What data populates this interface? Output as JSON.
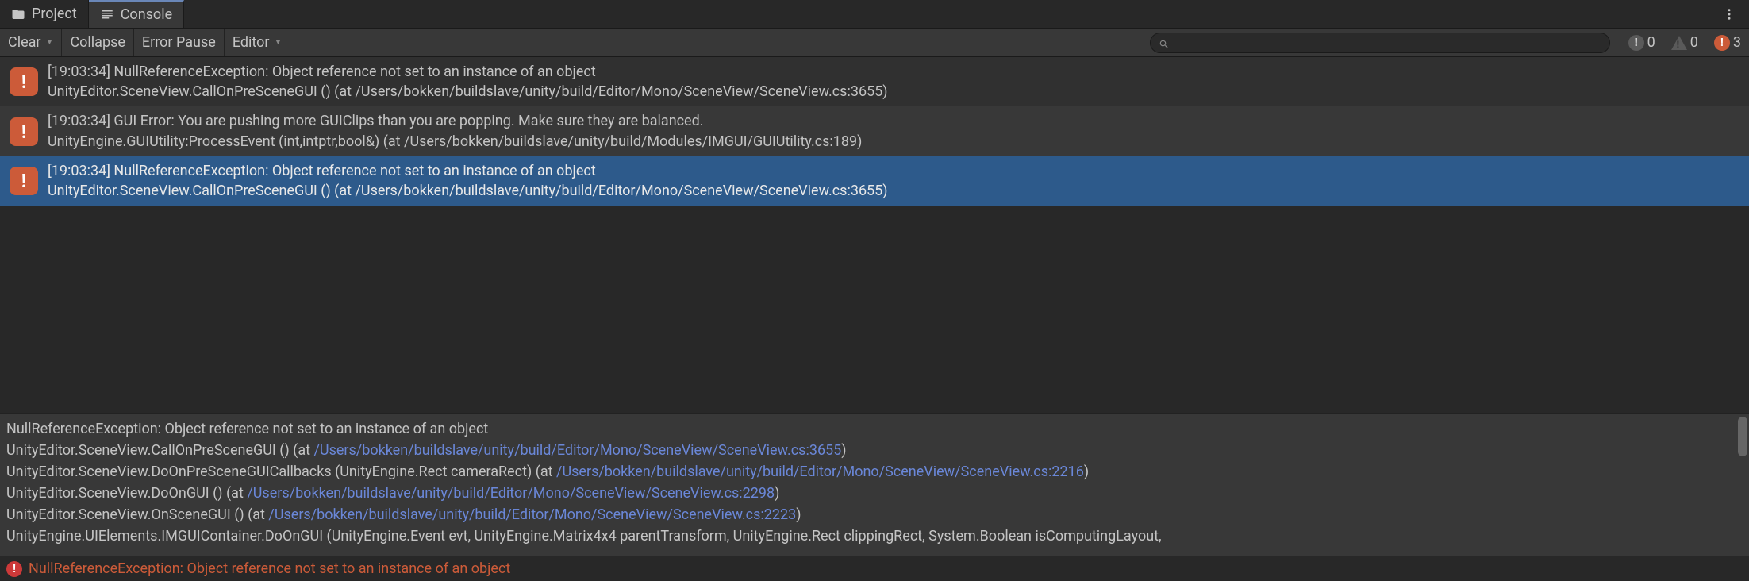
{
  "tabs": {
    "project": "Project",
    "console": "Console"
  },
  "toolbar": {
    "clear": "Clear",
    "collapse": "Collapse",
    "error_pause": "Error Pause",
    "editor": "Editor"
  },
  "search": {
    "placeholder": ""
  },
  "counters": {
    "info": "0",
    "warning": "0",
    "error": "3"
  },
  "logs": [
    {
      "line1": "[19:03:34] NullReferenceException: Object reference not set to an instance of an object",
      "line2": "UnityEditor.SceneView.CallOnPreSceneGUI () (at /Users/bokken/buildslave/unity/build/Editor/Mono/SceneView/SceneView.cs:3655)",
      "selected": false
    },
    {
      "line1": "[19:03:34] GUI Error: You are pushing more GUIClips than you are popping. Make sure they are balanced.",
      "line2": "UnityEngine.GUIUtility:ProcessEvent (int,intptr,bool&) (at /Users/bokken/buildslave/unity/build/Modules/IMGUI/GUIUtility.cs:189)",
      "selected": false
    },
    {
      "line1": "[19:03:34] NullReferenceException: Object reference not set to an instance of an object",
      "line2": "UnityEditor.SceneView.CallOnPreSceneGUI () (at /Users/bokken/buildslave/unity/build/Editor/Mono/SceneView/SceneView.cs:3655)",
      "selected": true
    }
  ],
  "detail": {
    "line0": "NullReferenceException: Object reference not set to an instance of an object",
    "line1_pre": "UnityEditor.SceneView.CallOnPreSceneGUI () (at ",
    "line1_link": "/Users/bokken/buildslave/unity/build/Editor/Mono/SceneView/SceneView.cs:3655",
    "line1_post": ")",
    "line2_pre": "UnityEditor.SceneView.DoOnPreSceneGUICallbacks (UnityEngine.Rect cameraRect) (at ",
    "line2_link": "/Users/bokken/buildslave/unity/build/Editor/Mono/SceneView/SceneView.cs:2216",
    "line2_post": ")",
    "line3_pre": "UnityEditor.SceneView.DoOnGUI () (at ",
    "line3_link": "/Users/bokken/buildslave/unity/build/Editor/Mono/SceneView/SceneView.cs:2298",
    "line3_post": ")",
    "line4_pre": "UnityEditor.SceneView.OnSceneGUI () (at ",
    "line4_link": "/Users/bokken/buildslave/unity/build/Editor/Mono/SceneView/SceneView.cs:2223",
    "line4_post": ")",
    "line5": "UnityEngine.UIElements.IMGUIContainer.DoOnGUI (UnityEngine.Event evt, UnityEngine.Matrix4x4 parentTransform, UnityEngine.Rect clippingRect, System.Boolean isComputingLayout,"
  },
  "status": {
    "text": "NullReferenceException: Object reference not set to an instance of an object"
  }
}
